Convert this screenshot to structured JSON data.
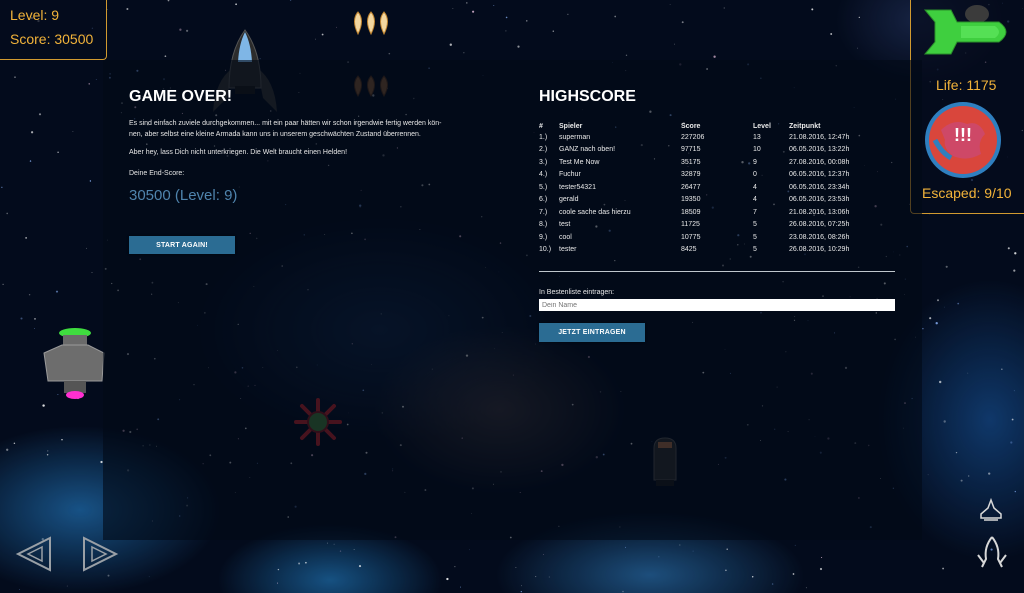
{
  "hud": {
    "level_text": "Level: 9",
    "score_text": "Score: 30500",
    "life_text": "Life: 1175",
    "escaped_text": "Escaped: 9/10",
    "planet_warning": "!!!",
    "accent_color": "#f2b33a"
  },
  "game_over": {
    "title": "GAME OVER!",
    "paragraph1": "Es sind einfach zuviele durchgekommen... mit ein paar hätten wir schon irgendwie fertig werden kön-",
    "paragraph1b": "nen, aber selbst eine kleine Armada kann uns in unserem geschwächten Zustand überrennen.",
    "paragraph2": "Aber hey, lass Dich nicht unterkriegen. Die Welt braucht einen Helden!",
    "end_score_label": "Deine End-Score:",
    "end_score_value": "30500 (Level: 9)",
    "restart_button": "START AGAIN!"
  },
  "highscore": {
    "title": "HIGHSCORE",
    "columns": [
      "#",
      "Spieler",
      "Score",
      "Level",
      "Zeitpunkt"
    ],
    "rows": [
      [
        "1.)",
        "superman",
        "227206",
        "13",
        "21.08.2016, 12:47h"
      ],
      [
        "2.)",
        "GANZ nach oben!",
        "97715",
        "10",
        "06.05.2016, 13:22h"
      ],
      [
        "3.)",
        "Test Me Now",
        "35175",
        "9",
        "27.08.2016, 00:08h"
      ],
      [
        "4.)",
        "Fuchur",
        "32879",
        "0",
        "06.05.2016, 12:37h"
      ],
      [
        "5.)",
        "tester54321",
        "26477",
        "4",
        "06.05.2016, 23:34h"
      ],
      [
        "6.)",
        "gerald",
        "19350",
        "4",
        "06.05.2016, 23:53h"
      ],
      [
        "7.)",
        "coole sache das hierzu",
        "18509",
        "7",
        "21.08.2016, 13:06h"
      ],
      [
        "8.)",
        "test",
        "11725",
        "5",
        "26.08.2016, 07:25h"
      ],
      [
        "9.)",
        "cool",
        "10775",
        "5",
        "23.08.2016, 08:26h"
      ],
      [
        "10.)",
        "tester",
        "8425",
        "5",
        "26.08.2016, 10:29h"
      ]
    ],
    "entry_label": "In Bestenliste eintragen:",
    "name_placeholder": "Dein Name",
    "submit_button": "JETZT EINTRAGEN"
  },
  "controls": {
    "left_icon": "arrow-left-icon",
    "right_icon": "arrow-right-icon",
    "ship_icon": "player-ship-outline-icon",
    "weapon_icon": "weapon-switch-icon"
  },
  "icons": {
    "player_ship": "player-ship-icon",
    "planet": "planet-icon",
    "rocket": "rocket-enemy-icon",
    "bombs": "bomb-cluster-icon",
    "ufo": "ufo-enemy-icon",
    "mine": "spiked-mine-icon",
    "capsule": "capsule-enemy-icon"
  }
}
